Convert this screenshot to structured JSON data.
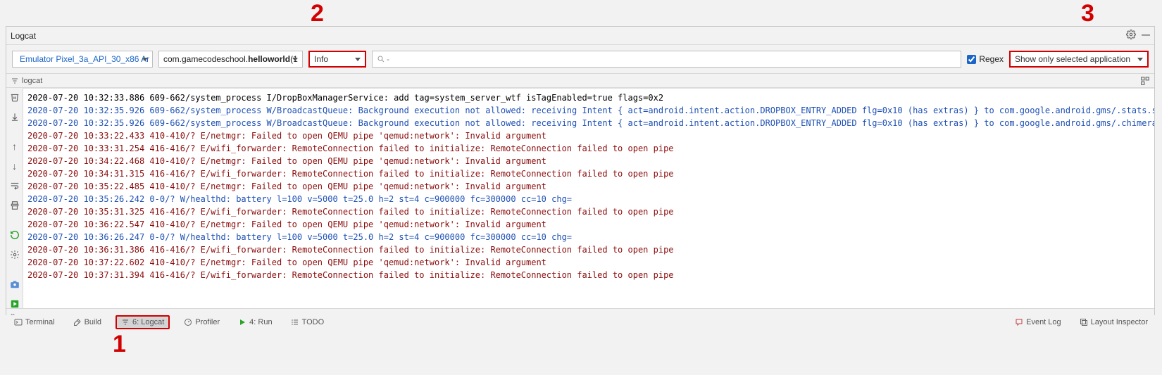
{
  "header": {
    "title": "Logcat"
  },
  "toolbar": {
    "device": "Emulator Pixel_3a_API_30_x86 Ar",
    "process_prefix": "com.gamecodeschool.",
    "process_bold": "helloworld",
    "process_suffix": " (1",
    "level": "Info",
    "search_placeholder": "",
    "regex_label": "Regex",
    "regex_checked": true,
    "filter": "Show only selected application"
  },
  "subbar": {
    "label": "logcat"
  },
  "logs": [
    {
      "lvl": "I",
      "text": "2020-07-20 10:32:33.886 609-662/system_process I/DropBoxManagerService: add tag=system_server_wtf isTagEnabled=true flags=0x2"
    },
    {
      "lvl": "W",
      "text": "2020-07-20 10:32:35.926 609-662/system_process W/BroadcastQueue: Background execution not allowed: receiving Intent { act=android.intent.action.DROPBOX_ENTRY_ADDED flg=0x10 (has extras) } to com.google.android.gms/.stats.service.D"
    },
    {
      "lvl": "W",
      "text": "2020-07-20 10:32:35.926 609-662/system_process W/BroadcastQueue: Background execution not allowed: receiving Intent { act=android.intent.action.DROPBOX_ENTRY_ADDED flg=0x10 (has extras) } to com.google.android.gms/.chimera.GmsInte"
    },
    {
      "lvl": "E",
      "text": "2020-07-20 10:33:22.433 410-410/? E/netmgr: Failed to open QEMU pipe 'qemud:network': Invalid argument"
    },
    {
      "lvl": "E",
      "text": "2020-07-20 10:33:31.254 416-416/? E/wifi_forwarder: RemoteConnection failed to initialize: RemoteConnection failed to open pipe"
    },
    {
      "lvl": "E",
      "text": "2020-07-20 10:34:22.468 410-410/? E/netmgr: Failed to open QEMU pipe 'qemud:network': Invalid argument"
    },
    {
      "lvl": "E",
      "text": "2020-07-20 10:34:31.315 416-416/? E/wifi_forwarder: RemoteConnection failed to initialize: RemoteConnection failed to open pipe"
    },
    {
      "lvl": "E",
      "text": "2020-07-20 10:35:22.485 410-410/? E/netmgr: Failed to open QEMU pipe 'qemud:network': Invalid argument"
    },
    {
      "lvl": "W",
      "text": "2020-07-20 10:35:26.242 0-0/? W/healthd: battery l=100 v=5000 t=25.0 h=2 st=4 c=900000 fc=300000 cc=10 chg="
    },
    {
      "lvl": "E",
      "text": "2020-07-20 10:35:31.325 416-416/? E/wifi_forwarder: RemoteConnection failed to initialize: RemoteConnection failed to open pipe"
    },
    {
      "lvl": "E",
      "text": "2020-07-20 10:36:22.547 410-410/? E/netmgr: Failed to open QEMU pipe 'qemud:network': Invalid argument"
    },
    {
      "lvl": "W",
      "text": "2020-07-20 10:36:26.247 0-0/? W/healthd: battery l=100 v=5000 t=25.0 h=2 st=4 c=900000 fc=300000 cc=10 chg="
    },
    {
      "lvl": "E",
      "text": "2020-07-20 10:36:31.386 416-416/? E/wifi_forwarder: RemoteConnection failed to initialize: RemoteConnection failed to open pipe"
    },
    {
      "lvl": "E",
      "text": "2020-07-20 10:37:22.602 410-410/? E/netmgr: Failed to open QEMU pipe 'qemud:network': Invalid argument"
    },
    {
      "lvl": "E",
      "text": "2020-07-20 10:37:31.394 416-416/? E/wifi_forwarder: RemoteConnection failed to initialize: RemoteConnection failed to open pipe"
    }
  ],
  "tabs": {
    "terminal": "Terminal",
    "build": "Build",
    "logcat": "6: Logcat",
    "profiler": "Profiler",
    "run": "4: Run",
    "todo": "TODO",
    "eventlog": "Event Log",
    "layoutinspector": "Layout Inspector"
  },
  "annotations": {
    "one": "1",
    "two": "2",
    "three": "3"
  }
}
